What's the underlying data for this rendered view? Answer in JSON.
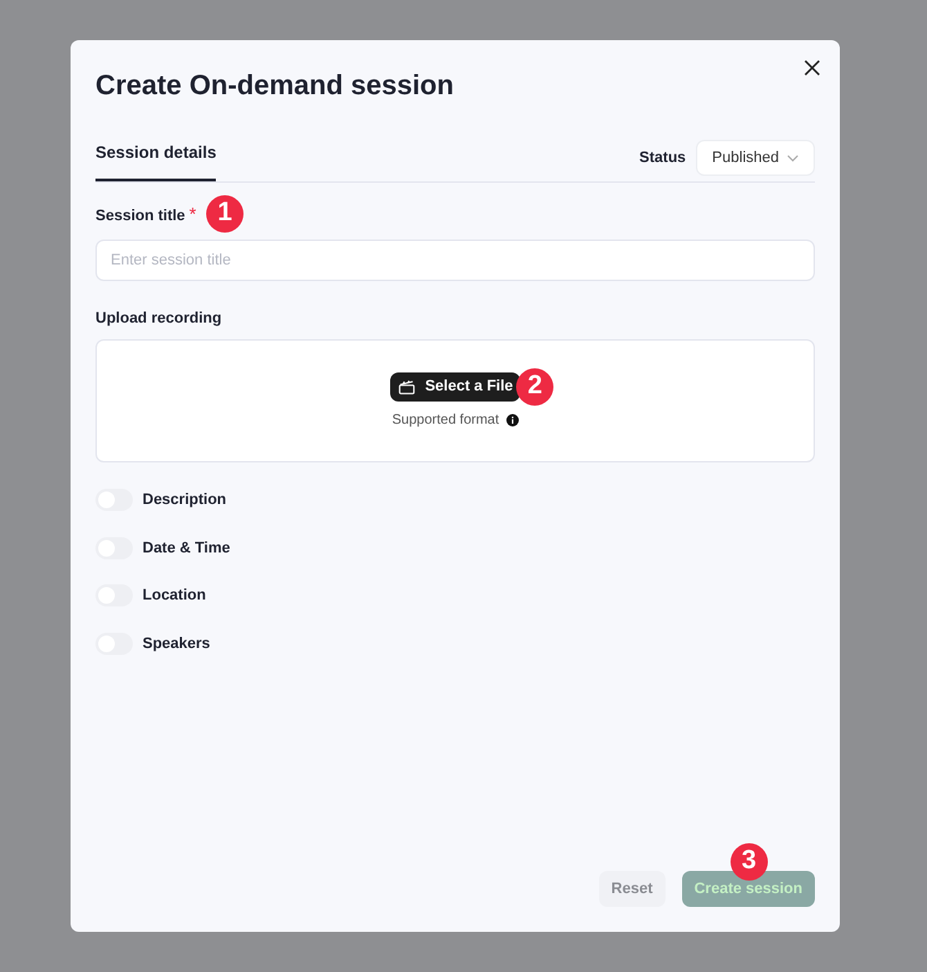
{
  "dialog": {
    "title": "Create On-demand session"
  },
  "tabs": [
    {
      "label": "Session details",
      "selected": true
    }
  ],
  "status": {
    "label": "Status",
    "value": "Published"
  },
  "session_title": {
    "label": "Session title",
    "required_mark": "*",
    "placeholder": "Enter session title",
    "badge": "1"
  },
  "upload": {
    "label": "Upload recording",
    "button": "Select a File",
    "badge": "2",
    "hint": "Supported format"
  },
  "toggles": [
    {
      "label": "Description",
      "on": false
    },
    {
      "label": "Date & Time",
      "on": false
    },
    {
      "label": "Location",
      "on": false
    },
    {
      "label": "Speakers",
      "on": false
    }
  ],
  "footer": {
    "reset": "Reset",
    "create": "Create session",
    "create_disabled": true,
    "badge": "3"
  }
}
